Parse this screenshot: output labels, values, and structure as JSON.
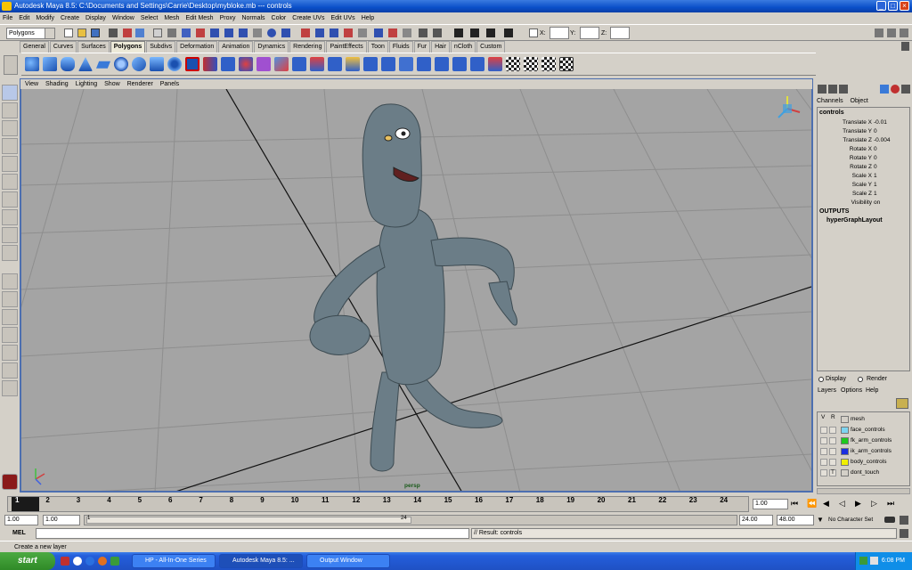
{
  "window": {
    "title": "Autodesk Maya 8.5: C:\\Documents and Settings\\Carrie\\Desktop\\mybloke.mb   ---   controls"
  },
  "menus": [
    "File",
    "Edit",
    "Modify",
    "Create",
    "Display",
    "Window",
    "Select",
    "Mesh",
    "Edit Mesh",
    "Proxy",
    "Normals",
    "Color",
    "Create UVs",
    "Edit UVs",
    "Help"
  ],
  "status": {
    "mode": "Polygons",
    "x_label": "X:",
    "y_label": "Y:",
    "z_label": "Z:"
  },
  "shelf_tabs": [
    "General",
    "Curves",
    "Surfaces",
    "Polygons",
    "Subdivs",
    "Deformation",
    "Animation",
    "Dynamics",
    "Rendering",
    "PaintEffects",
    "Toon",
    "Fluids",
    "Fur",
    "Hair",
    "nCloth",
    "Custom"
  ],
  "active_shelf": "Polygons",
  "panel_menu": [
    "View",
    "Shading",
    "Lighting",
    "Show",
    "Renderer",
    "Panels"
  ],
  "viewport": {
    "camera": "persp"
  },
  "channel_box": {
    "tabs": [
      "Channels",
      "Object"
    ],
    "object": "controls",
    "channels": [
      {
        "name": "Translate X",
        "value": "-0.01"
      },
      {
        "name": "Translate Y",
        "value": "0"
      },
      {
        "name": "Translate Z",
        "value": "-0.004"
      },
      {
        "name": "Rotate X",
        "value": "0"
      },
      {
        "name": "Rotate Y",
        "value": "0"
      },
      {
        "name": "Rotate Z",
        "value": "0"
      },
      {
        "name": "Scale X",
        "value": "1"
      },
      {
        "name": "Scale Y",
        "value": "1"
      },
      {
        "name": "Scale Z",
        "value": "1"
      },
      {
        "name": "Visibility",
        "value": "on"
      }
    ],
    "outputs_label": "OUTPUTS",
    "output_node": "hyperGraphLayout"
  },
  "layer_editor": {
    "modes": [
      "Display",
      "Render"
    ],
    "menus": [
      "Layers",
      "Options",
      "Help"
    ],
    "header_v": "V",
    "header_r": "R",
    "layers": [
      {
        "name": "mesh",
        "color": "#d4d0c8",
        "r": ""
      },
      {
        "name": "face_controls",
        "color": "#7ed4f0",
        "r": ""
      },
      {
        "name": "fk_arm_controls",
        "color": "#1ec81e",
        "r": ""
      },
      {
        "name": "ik_arm_controls",
        "color": "#1a2ee0",
        "r": ""
      },
      {
        "name": "body_controls",
        "color": "#f0f000",
        "r": ""
      },
      {
        "name": "dont_touch",
        "color": "#d4d0c8",
        "r": "T"
      }
    ]
  },
  "timeline": {
    "ticks": [
      "1",
      "2",
      "3",
      "4",
      "5",
      "6",
      "7",
      "8",
      "9",
      "10",
      "11",
      "12",
      "13",
      "14",
      "15",
      "16",
      "17",
      "18",
      "19",
      "20",
      "21",
      "22",
      "23",
      "24"
    ],
    "current_frame": "1.00"
  },
  "range": {
    "start": "1.00",
    "anim_start": "1.00",
    "slider_start": "1",
    "slider_end": "24",
    "end": "24.00",
    "anim_end": "48.00",
    "character": "No Character Set"
  },
  "script": {
    "label": "MEL",
    "result": "// Result: controls"
  },
  "help": {
    "text": "Create a new layer"
  },
  "taskbar": {
    "start": "start",
    "tasks": [
      "HP - All-In-One Series",
      "Autodesk Maya 8.5: ...",
      "Output Window"
    ],
    "time": "6:08 PM"
  }
}
